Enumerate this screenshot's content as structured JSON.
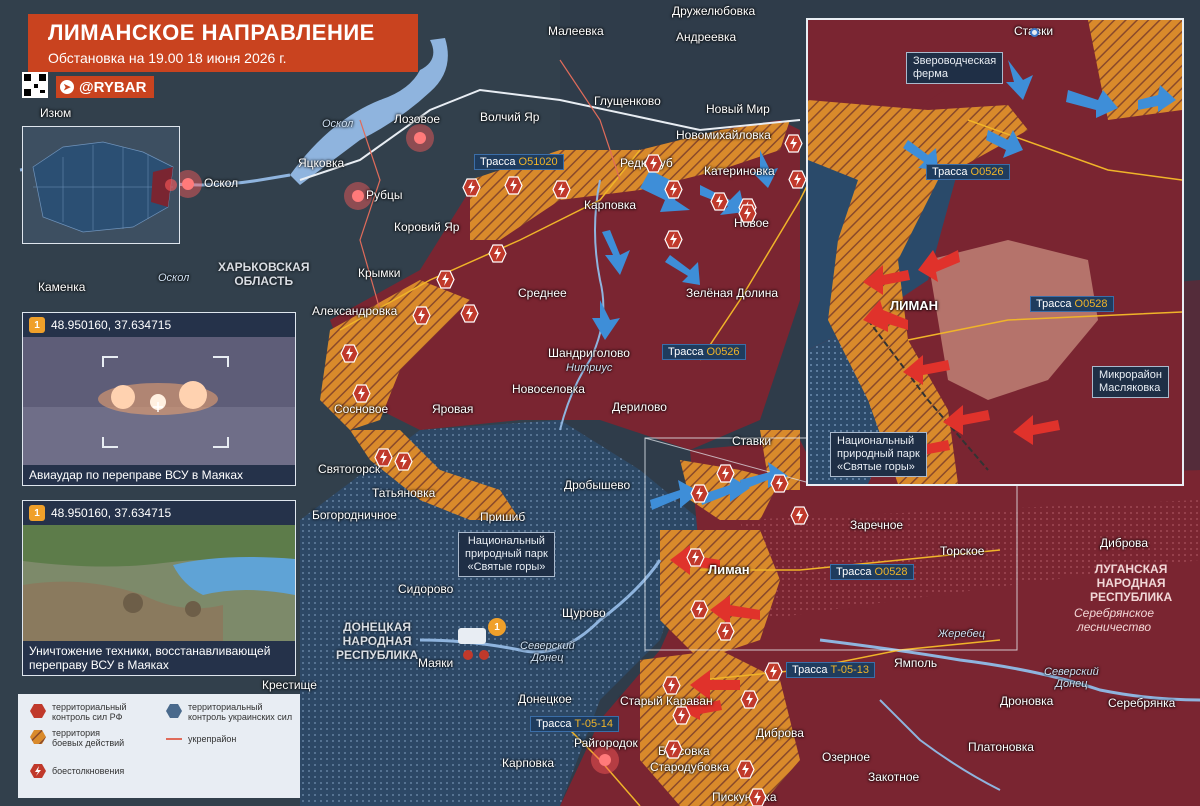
{
  "header": {
    "title": "ЛИМАНСКОЕ НАПРАВЛЕНИЕ",
    "subtitle": "Обстановка на 19.00 18 июня 2026 г.",
    "handle": "@RYBAR"
  },
  "colors": {
    "ru_control": "#7a2531",
    "contested": "#d98a2b",
    "ua_control": "#2c4a6a",
    "clash": "#c0392b",
    "accent": "#c9431f"
  },
  "settlements": [
    {
      "name": "Дружелюбовка"
    },
    {
      "name": "Малеевка"
    },
    {
      "name": "Андреевка"
    },
    {
      "name": "Изюм"
    },
    {
      "name": "Оскол"
    },
    {
      "name": "Лозовое"
    },
    {
      "name": "Яцковка"
    },
    {
      "name": "Рубцы"
    },
    {
      "name": "Волчий Яр"
    },
    {
      "name": "Глущенково"
    },
    {
      "name": "Новый Мир"
    },
    {
      "name": "Новомихайловка"
    },
    {
      "name": "Редкодуб"
    },
    {
      "name": "Катериновка"
    },
    {
      "name": "Карповка"
    },
    {
      "name": "Новое"
    },
    {
      "name": "Коровий Яр"
    },
    {
      "name": "Крымки"
    },
    {
      "name": "Каменка"
    },
    {
      "name": "Среднее"
    },
    {
      "name": "Зелёная Долина"
    },
    {
      "name": "Александровка"
    },
    {
      "name": "Шандриголово"
    },
    {
      "name": "Новоселовка"
    },
    {
      "name": "Дерилово"
    },
    {
      "name": "Сосновое"
    },
    {
      "name": "Яровая"
    },
    {
      "name": "Ставки"
    },
    {
      "name": "Святогорск"
    },
    {
      "name": "Татьяновка"
    },
    {
      "name": "Дробышево"
    },
    {
      "name": "Богородничное"
    },
    {
      "name": "Пришиб"
    },
    {
      "name": "Лиман"
    },
    {
      "name": "Заречное"
    },
    {
      "name": "Торское"
    },
    {
      "name": "Дибровa"
    },
    {
      "name": "Сидорово"
    },
    {
      "name": "Щурово"
    },
    {
      "name": "Маяки"
    },
    {
      "name": "Крестище"
    },
    {
      "name": "Ямполь"
    },
    {
      "name": "Донецкое"
    },
    {
      "name": "Старый Караван"
    },
    {
      "name": "Дроновка"
    },
    {
      "name": "Серебрянка"
    },
    {
      "name": "Райгородок"
    },
    {
      "name": "Брусовка"
    },
    {
      "name": "Диброва"
    },
    {
      "name": "Озерное"
    },
    {
      "name": "Платоновка"
    },
    {
      "name": "Карповка"
    },
    {
      "name": "Стародубовка"
    },
    {
      "name": "Закотное"
    },
    {
      "name": "Пискуновка"
    }
  ],
  "regions": {
    "kharkiv": "ХАРЬКОВСКАЯ\nОБЛАСТЬ",
    "donetsk": "ДОНЕЦКАЯ\nНАРОДНАЯ\nРЕСПУБЛИКА",
    "luhansk": "ЛУГАНСКАЯ\nНАРОДНАЯ\nРЕСПУБЛИКА",
    "park": "Национальный\nприродный парк\n«Святые горы»",
    "forest": "Серебрянское\nлесничество"
  },
  "rivers": {
    "oskol_1": "Оскол",
    "oskol_2": "Оскол",
    "nitrius": "Нитриус",
    "donets": "Северский\nДонец",
    "zherebets": "Жеребец",
    "donets_2": "Северский\nДонец"
  },
  "roads": [
    {
      "prefix": "Трасса ",
      "num": "О51020"
    },
    {
      "prefix": "Трасса ",
      "num": "О0526"
    },
    {
      "prefix": "Трасса ",
      "num": "О0528"
    },
    {
      "prefix": "Трасса ",
      "num": "Т-05-13"
    },
    {
      "prefix": "Трасса ",
      "num": "Т-05-14"
    }
  ],
  "inset": {
    "labels": {
      "stavki": "Ставки",
      "farm": "Звероводческая\nферма",
      "road526_prefix": "Трасса ",
      "road526": "О0526",
      "liman": "ЛИМАН",
      "road528_prefix": "Трасса ",
      "road528": "О0528",
      "micro": "Микрорайон\nМасляковка",
      "park": "Национальный\nприродный парк\n«Святые горы»"
    }
  },
  "media": [
    {
      "badge": "1",
      "coords": "48.950160, 37.634715",
      "caption": "Авиаудар по переправе ВСУ в Маяках"
    },
    {
      "badge": "1",
      "coords": "48.950160, 37.634715",
      "caption": "Уничтожение техники, восстанавливающей\nпереправу ВСУ в Маяках"
    }
  ],
  "map_marker": "1",
  "legend": {
    "ru": "территориальный\nконтроль сил РФ",
    "ua": "территориальный\nконтроль украинских сил",
    "combat": "территория\nбоевых действий",
    "fort": "укрепрайон",
    "clash": "боестолкновения"
  }
}
